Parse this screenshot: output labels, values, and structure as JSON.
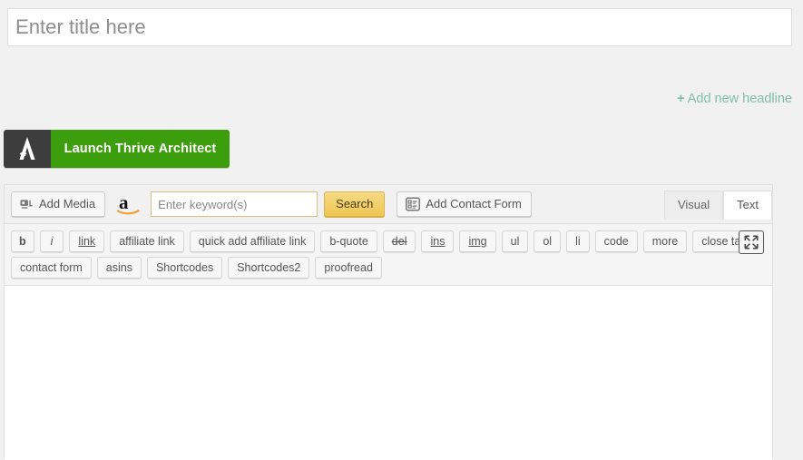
{
  "title_field": {
    "placeholder": "Enter title here",
    "value": ""
  },
  "headline": {
    "plus": "+",
    "label": "Add new headline",
    "color": "#7fbfaa"
  },
  "thrive": {
    "label": "Launch Thrive Architect",
    "icon_name": "thrive-architect-logo",
    "icon_bg": "#3d3d3d",
    "button_bg": "#3c9e0c"
  },
  "media_bar": {
    "add_media_label": "Add Media",
    "amazon_icon_name": "amazon-logo",
    "keyword_placeholder": "Enter keyword(s)",
    "keyword_value": "",
    "search_label": "Search",
    "search_bg": "#f3cf6c",
    "contact_form_label": "Add Contact Form"
  },
  "tabs": [
    {
      "label": "Visual",
      "active": false
    },
    {
      "label": "Text",
      "active": true
    }
  ],
  "quicktags": {
    "row1": [
      {
        "label": "b",
        "style": "b"
      },
      {
        "label": "i",
        "style": "i"
      },
      {
        "label": "link",
        "style": "u"
      },
      {
        "label": "affiliate link",
        "style": ""
      },
      {
        "label": "quick add affiliate link",
        "style": ""
      },
      {
        "label": "b-quote",
        "style": ""
      },
      {
        "label": "del",
        "style": "s"
      },
      {
        "label": "ins",
        "style": "u"
      },
      {
        "label": "img",
        "style": "u"
      },
      {
        "label": "ul",
        "style": ""
      },
      {
        "label": "ol",
        "style": ""
      },
      {
        "label": "li",
        "style": ""
      },
      {
        "label": "code",
        "style": ""
      },
      {
        "label": "more",
        "style": ""
      },
      {
        "label": "close tags",
        "style": ""
      }
    ],
    "row2": [
      {
        "label": "contact form",
        "style": ""
      },
      {
        "label": "asins",
        "style": ""
      },
      {
        "label": "Shortcodes",
        "style": ""
      },
      {
        "label": "Shortcodes2",
        "style": ""
      },
      {
        "label": "proofread",
        "style": ""
      }
    ],
    "fullscreen_icon_name": "distraction-free-expand-icon"
  },
  "content": {
    "value": "",
    "placeholder": ""
  }
}
